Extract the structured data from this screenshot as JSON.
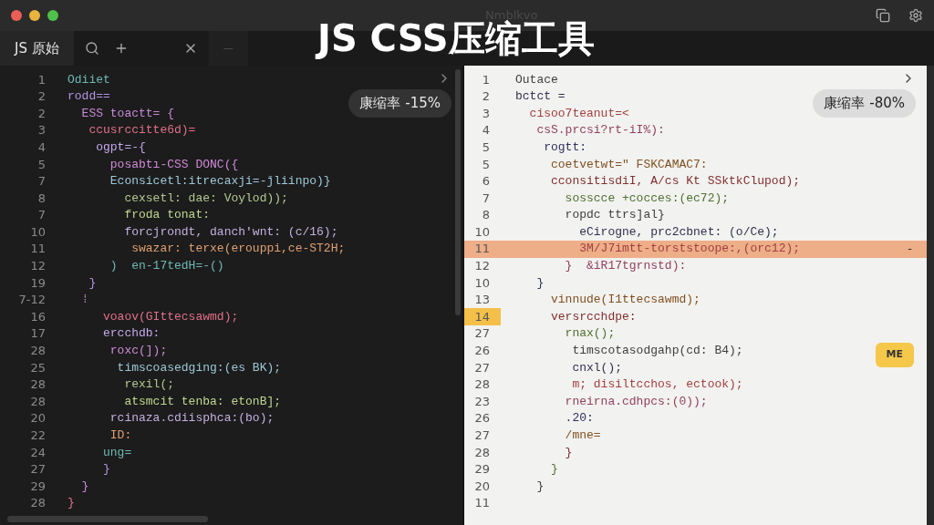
{
  "window": {
    "title": "Nmblkvo"
  },
  "overlay_title": "JS CSS压缩工具",
  "tabs": [
    {
      "label": "JS 原始",
      "selected": true
    },
    {
      "label": "—",
      "selected": false
    }
  ],
  "panes": [
    {
      "kind": "dark",
      "badge": "康缩率 -15%",
      "lines": [
        {
          "number": "1",
          "text": "Odiiet"
        },
        {
          "number": "2",
          "text": "rodd=="
        },
        {
          "number": "2",
          "text": "  ESS toactt= {"
        },
        {
          "number": "3",
          "text": "   ccusrccitte6d)="
        },
        {
          "number": "4",
          "text": "    ogpt=-{"
        },
        {
          "number": "5",
          "text": "      posabtı-CSS DONC({"
        },
        {
          "number": "7",
          "text": "      Econsicetl:itrecaxji=-ǰliinpo)}"
        },
        {
          "number": "8",
          "text": "        cexsetl: dae: Voylod));"
        },
        {
          "number": "7",
          "text": "        froda tonat:"
        },
        {
          "number": "10",
          "text": "        forcjrondt, danch'wnt: (c/16);"
        },
        {
          "number": "11",
          "text": "         swazar: terxe(erouppi,ce-ST2H;"
        },
        {
          "number": "12",
          "text": "      )  en-17tedH=-()"
        },
        {
          "number": "19",
          "text": "   }"
        },
        {
          "number": "7-12",
          "text": "  ⁞"
        },
        {
          "number": "16",
          "text": "     voaov(GIttecsawmd);"
        },
        {
          "number": "17",
          "text": "     ercchdb:"
        },
        {
          "number": "28",
          "text": "      roxc(]);"
        },
        {
          "number": "25",
          "text": "       timscoasedging:(es BK);"
        },
        {
          "number": "28",
          "text": "        rexil(;"
        },
        {
          "number": "28",
          "text": "        atsmcit tenba: etonB];"
        },
        {
          "number": "20",
          "text": "      rcinaza.cdiisphca:(bo);"
        },
        {
          "number": "22",
          "text": "      ID:"
        },
        {
          "number": "24",
          "text": "     ung="
        },
        {
          "number": "27",
          "text": "     }"
        },
        {
          "number": "29",
          "text": "  }"
        },
        {
          "number": "28",
          "text": "}"
        }
      ]
    },
    {
      "kind": "light",
      "badge": "康缩率 -80%",
      "lines": [
        {
          "number": "1",
          "text": "Outace",
          "highlighted": false,
          "current": false
        },
        {
          "number": "2",
          "text": "bctct =",
          "highlighted": false,
          "current": false
        },
        {
          "number": "3",
          "text": "  cisoo7teanut=<",
          "highlighted": false,
          "current": false
        },
        {
          "number": "4",
          "text": "   csS.prcsi?rt-iI%):",
          "highlighted": false,
          "current": false
        },
        {
          "number": "5",
          "text": "    rogtt:",
          "highlighted": false,
          "current": false
        },
        {
          "number": "5",
          "text": "     coetvetwt=\" FSKCAMAC7:",
          "highlighted": false,
          "current": false
        },
        {
          "number": "6",
          "text": "     cconsitisdiI, A/cs Kt SSktkClupod);",
          "highlighted": false,
          "current": false
        },
        {
          "number": "7",
          "text": "       sosscce +cocces:(ec72);",
          "highlighted": false,
          "current": false
        },
        {
          "number": "8",
          "text": "       ropdc ttrs]al}",
          "highlighted": false,
          "current": false
        },
        {
          "number": "10",
          "text": "         eCirogne, prc2cbnet: (o/Ce);",
          "highlighted": false,
          "current": false
        },
        {
          "number": "11",
          "text": "         3M/J7imtt-torststoope:,(orc12);",
          "highlighted": true,
          "current": false,
          "trail": "-"
        },
        {
          "number": "12",
          "text": "       }  &iR17tgrnstd):",
          "highlighted": false,
          "current": false
        },
        {
          "number": "10",
          "text": "   }",
          "highlighted": false,
          "current": false
        },
        {
          "number": "13",
          "text": "     vinnude(I1ttecsawmd);",
          "highlighted": false,
          "current": false
        },
        {
          "number": "14",
          "text": "     versrcchdpe:",
          "highlighted": false,
          "current": true
        },
        {
          "number": "27",
          "text": "       rnax();",
          "highlighted": false,
          "current": false
        },
        {
          "number": "26",
          "text": "        timscotasodgahp(cd: B4);",
          "highlighted": false,
          "current": false
        },
        {
          "number": "27",
          "text": "        cnxl();",
          "highlighted": false,
          "current": false
        },
        {
          "number": "28",
          "text": "        m; disiltcchos, ectook);",
          "highlighted": false,
          "current": false
        },
        {
          "number": "23",
          "text": "       rneirna.cdhpcs:(0));",
          "highlighted": false,
          "current": false
        },
        {
          "number": "26",
          "text": "       .20:",
          "highlighted": false,
          "current": false
        },
        {
          "number": "27",
          "text": "       /mne=",
          "highlighted": false,
          "current": false
        },
        {
          "number": "28",
          "text": "       }",
          "highlighted": false,
          "current": false
        },
        {
          "number": "29",
          "text": "     }",
          "highlighted": false,
          "current": false
        },
        {
          "number": "20",
          "text": "   }",
          "highlighted": false,
          "current": false
        },
        {
          "number": "11",
          "highlighted": false,
          "current": false
        }
      ],
      "tag": "ME"
    }
  ]
}
